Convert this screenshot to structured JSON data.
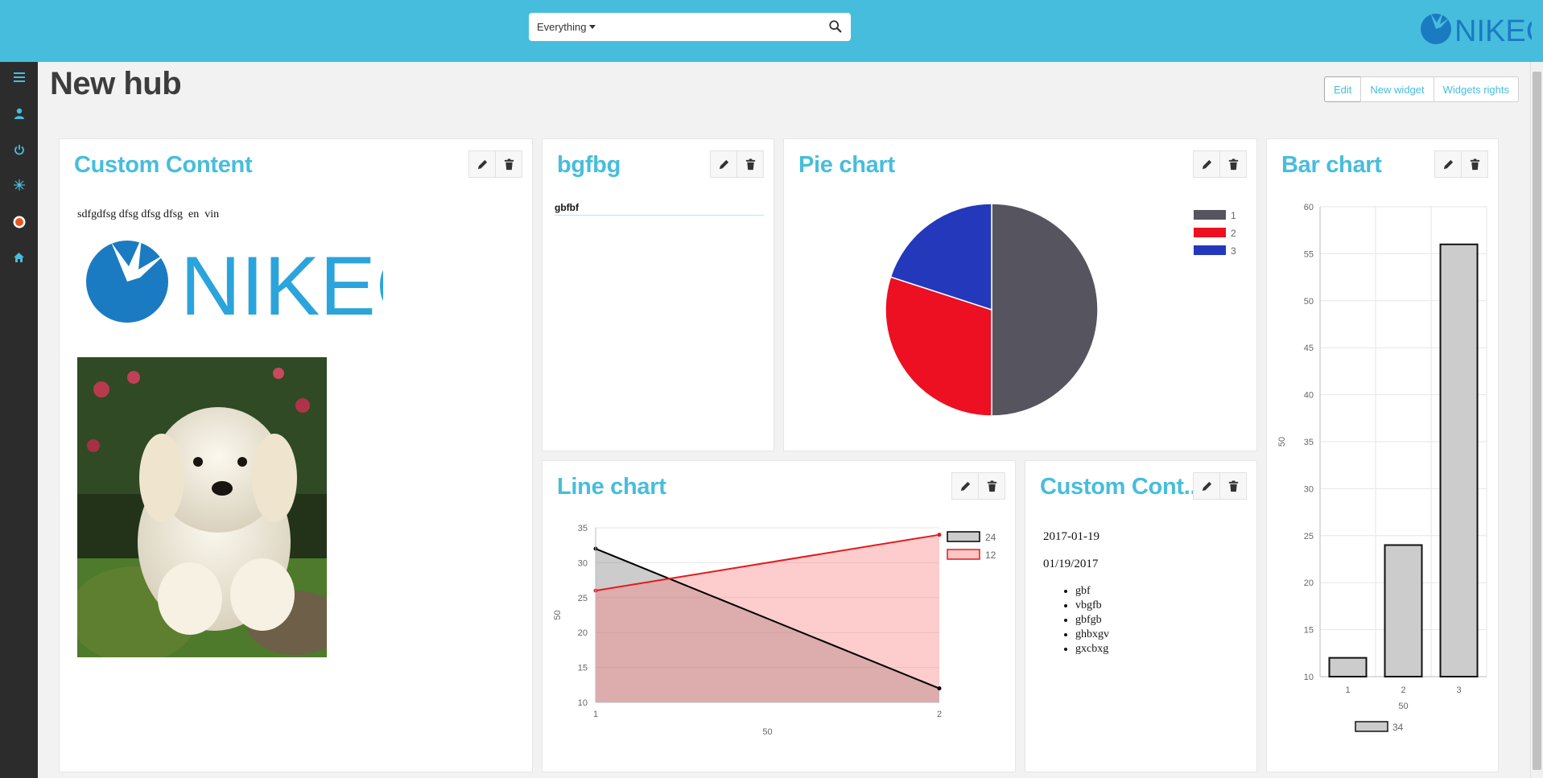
{
  "header": {
    "search_scope": "Everything",
    "search_value": "",
    "brand": "NIKEC",
    "brand_color": "#1a7bc2",
    "topbar_color": "#47bddd"
  },
  "sidebar": {
    "items": [
      {
        "icon": "menu-icon"
      },
      {
        "icon": "user-icon"
      },
      {
        "icon": "power-icon"
      },
      {
        "icon": "network-icon"
      },
      {
        "icon": "record-icon"
      },
      {
        "icon": "home-icon"
      }
    ]
  },
  "page": {
    "title": "New hub",
    "buttons": {
      "edit": "Edit",
      "new_widget": "New widget",
      "widgets_rights": "Widgets rights"
    }
  },
  "widgets": {
    "custom1": {
      "title": "Custom Content",
      "text": "sdfgdfsg dfsg dfsg dfsg  en  vin",
      "logo_text": "NIKEC"
    },
    "bgfbg": {
      "title": "bgfbg",
      "item": "gbfbf"
    },
    "pie": {
      "title": "Pie chart"
    },
    "bar": {
      "title": "Bar chart"
    },
    "line": {
      "title": "Line chart"
    },
    "custom2": {
      "title": "Custom Cont...",
      "date1": "2017-01-19",
      "date2": "01/19/2017",
      "list": [
        "gbf",
        "vbgfb",
        "gbfgb",
        "ghbxgv",
        "gxcbxg"
      ]
    }
  },
  "chart_data": [
    {
      "type": "pie",
      "title": "Pie chart",
      "categories": [
        "1",
        "2",
        "3"
      ],
      "values": [
        50,
        30,
        20
      ],
      "colors": [
        "#56555f",
        "#ec1022",
        "#2338bb"
      ],
      "legend": "top-right"
    },
    {
      "type": "bar",
      "title": "Bar chart",
      "categories": [
        "1",
        "2",
        "3"
      ],
      "series": [
        {
          "name": "34",
          "values": [
            12,
            24,
            56
          ]
        }
      ],
      "xlabel": "50",
      "ylabel": "50",
      "ylim": [
        10,
        60
      ],
      "yticks": [
        10,
        15,
        20,
        25,
        30,
        35,
        40,
        45,
        50,
        55,
        60
      ],
      "grid": true,
      "legend": "bottom",
      "colors": [
        "#cccccc"
      ]
    },
    {
      "type": "area",
      "title": "Line chart",
      "categories": [
        "1",
        "2"
      ],
      "series": [
        {
          "name": "24",
          "values": [
            32,
            12
          ],
          "color": "#000000"
        },
        {
          "name": "12",
          "values": [
            26,
            34
          ],
          "color": "#e31a1c"
        }
      ],
      "xlabel": "50",
      "ylabel": "50",
      "ylim": [
        10,
        35
      ],
      "yticks": [
        10,
        15,
        20,
        25,
        30,
        35
      ],
      "grid": true,
      "legend": "top-right"
    }
  ]
}
